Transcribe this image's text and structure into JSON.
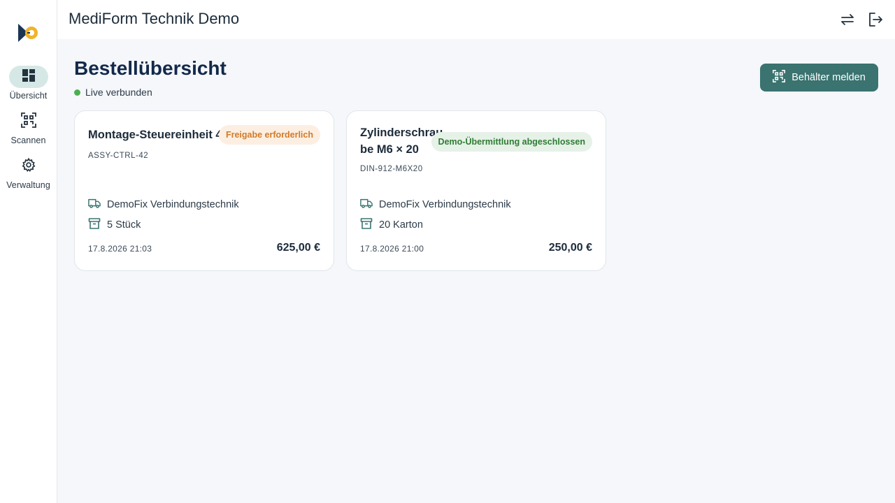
{
  "app": {
    "title": "MediForm Technik Demo"
  },
  "nav": [
    {
      "label": "Übersicht",
      "icon": "dashboard-icon",
      "active": true
    },
    {
      "label": "Scannen",
      "icon": "qr-scan-icon",
      "active": false
    },
    {
      "label": "Verwaltung",
      "icon": "gear-icon",
      "active": false
    }
  ],
  "topbar": {
    "icons": [
      "swap-icon",
      "logout-icon"
    ]
  },
  "page": {
    "title": "Bestellübersicht",
    "status": "Live verbunden",
    "primary_action": "Behälter melden"
  },
  "orders": [
    {
      "title": "Montage-Steuereinheit 42",
      "badge": "Freigabe erforderlich",
      "badge_type": "warning",
      "sku": "ASSY-CTRL-42",
      "supplier": "DemoFix Verbindungstechnik",
      "quantity": "5 Stück",
      "date": "17.8.2026 21:03",
      "price": "625,00 €"
    },
    {
      "title_lines": [
        "Zylinderschrau",
        "be M6 × 20"
      ],
      "badge": "Demo-Übermittlung abgeschlossen",
      "badge_type": "success",
      "sku": "DIN-912-M6X20",
      "supplier": "DemoFix Verbindungstechnik",
      "quantity": "20 Karton",
      "date": "17.8.2026 21:00",
      "price": "250,00 €"
    }
  ],
  "colors": {
    "accent": "#3a7370",
    "nav_active": "#d6e8e6",
    "live": "#4caf50",
    "badge_warning_bg": "#fcefe2",
    "badge_warning_text": "#d27a28",
    "badge_success_bg": "#e6f1e8",
    "badge_success_text": "#2e7d32"
  }
}
